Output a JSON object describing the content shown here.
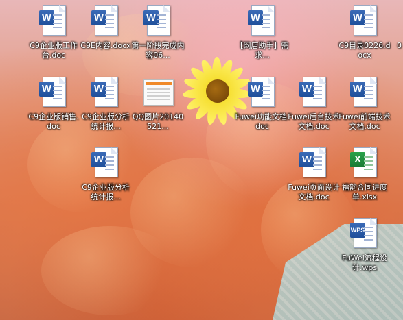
{
  "desktop": {
    "icons": [
      {
        "label": "C9企业版工作台.doc",
        "icon": "word-doc-icon"
      },
      {
        "label": "C9E内容.docx",
        "icon": "word-doc-icon"
      },
      {
        "label": "第一阶段完成内容06...",
        "icon": "word-doc-icon"
      },
      {
        "label": "【网店助手】需求...",
        "icon": "word-doc-icon"
      },
      {
        "label": "C9目录0226.docx",
        "icon": "word-doc-icon"
      },
      {
        "label": "C9企业版销售.doc",
        "icon": "word-doc-icon"
      },
      {
        "label": "C9企业版分析统计报...",
        "icon": "word-doc-icon"
      },
      {
        "label": "QQ图片20140521...",
        "icon": "image-thumbnail-icon"
      },
      {
        "label": "Fuwei功能文档.doc",
        "icon": "word-doc-icon"
      },
      {
        "label": "Fuwei后台技术文档.doc",
        "icon": "word-doc-icon"
      },
      {
        "label": "Fuwei前端技术文档.doc",
        "icon": "word-doc-icon"
      },
      {
        "label": "C9企业版分析统计报...",
        "icon": "word-doc-icon"
      },
      {
        "label": "Fuwei页面设计文档.doc",
        "icon": "word-doc-icon"
      },
      {
        "label": "福韵合同进度单.xlsx",
        "icon": "excel-xlsx-icon"
      },
      {
        "label": "FuWei流程设计.wps",
        "icon": "wps-doc-icon"
      }
    ],
    "partial_labels": [
      "0"
    ]
  }
}
